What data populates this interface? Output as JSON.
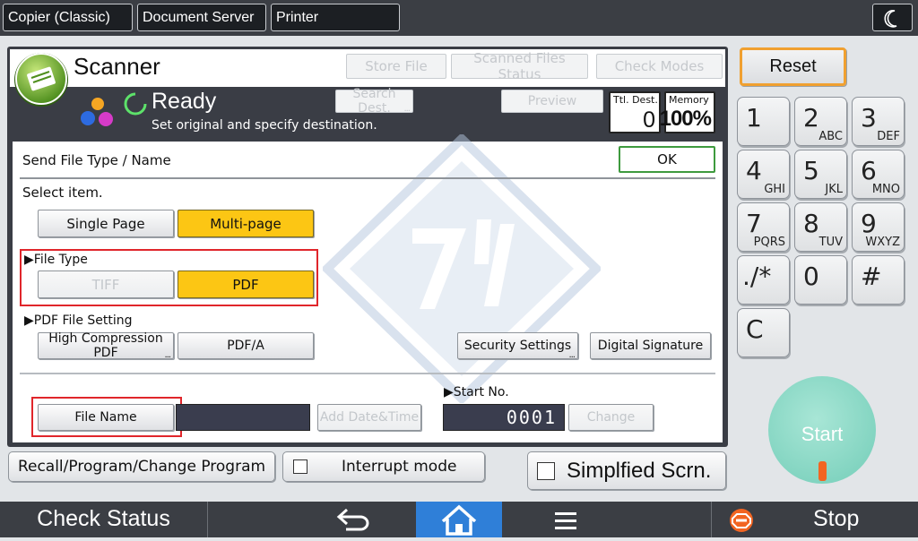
{
  "top_tabs": [
    "Copier (Classic)",
    "Document Server",
    "Printer"
  ],
  "app": {
    "title": "Scanner",
    "status": "Ready",
    "message": "Set original and specify destination."
  },
  "header_buttons": {
    "store_file": "Store File",
    "scanned_files_status": "Scanned Files Status",
    "check_modes": "Check Modes"
  },
  "status_buttons": {
    "search_dest": "Search Dest.",
    "preview": "Preview"
  },
  "counters": {
    "ttl_dest_label": "Ttl. Dest.",
    "ttl_dest_value": "0",
    "memory_label": "Memory",
    "memory_value": "100%"
  },
  "dialog": {
    "title": "Send File Type / Name",
    "ok": "OK",
    "select_item": "Select item.",
    "single_page": "Single Page",
    "multi_page": "Multi-page",
    "file_type_label": "File Type",
    "tiff": "TIFF",
    "pdf": "PDF",
    "pdf_setting_label": "PDF File Setting",
    "high_compression": "High Compression PDF",
    "pdfa": "PDF/A",
    "security_settings": "Security Settings",
    "digital_signature": "Digital Signature",
    "file_name": "File Name",
    "file_name_value": "",
    "add_date_time": "Add Date&Time",
    "start_no_label": "Start No.",
    "start_no_value": "0001",
    "change": "Change"
  },
  "bottom_row": {
    "recall": "Recall/Program/Change Program",
    "interrupt": "Interrupt mode",
    "simplified": "Simplfied Scrn."
  },
  "keypad": {
    "reset": "Reset",
    "keys": [
      {
        "main": "1",
        "sub": ""
      },
      {
        "main": "2",
        "sub": "ABC"
      },
      {
        "main": "3",
        "sub": "DEF"
      },
      {
        "main": "4",
        "sub": "GHI"
      },
      {
        "main": "5",
        "sub": "JKL"
      },
      {
        "main": "6",
        "sub": "MNO"
      },
      {
        "main": "7",
        "sub": "PQRS"
      },
      {
        "main": "8",
        "sub": "TUV"
      },
      {
        "main": "9",
        "sub": "WXYZ"
      },
      {
        "main": "./*",
        "sub": ""
      },
      {
        "main": "0",
        "sub": ""
      },
      {
        "main": "#",
        "sub": ""
      },
      {
        "main": "C",
        "sub": ""
      }
    ],
    "start": "Start"
  },
  "bottom_bar": {
    "check_status": "Check Status",
    "stop": "Stop"
  },
  "icons": [
    "moon-icon",
    "scanner-app-icon",
    "color-dots-icon",
    "ready-ring-icon",
    "back-arrow-icon",
    "home-icon",
    "menu-icon",
    "stop-icon",
    "checkbox-icon"
  ],
  "colors": {
    "selected": "#fcc614",
    "highlight_box": "#e0262b",
    "start": "#73cdb8",
    "home_active": "#2f7fd8",
    "reset_border": "#f0a030"
  }
}
